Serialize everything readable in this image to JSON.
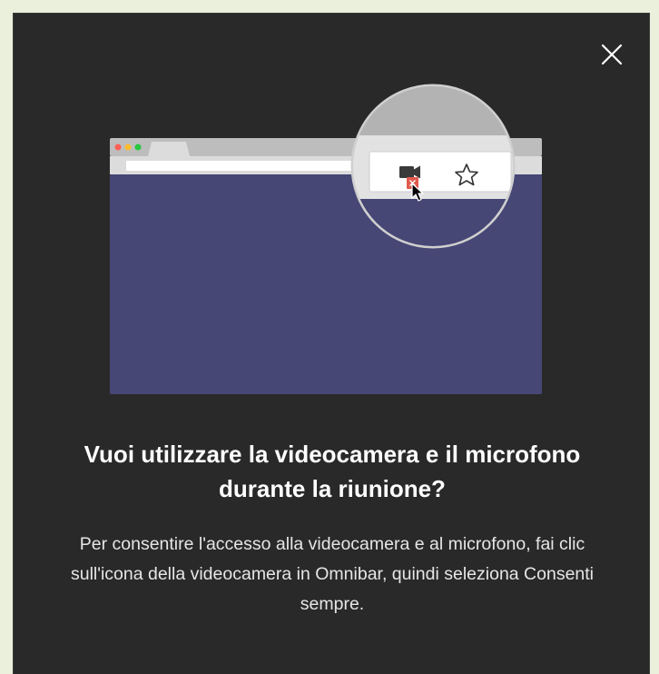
{
  "dialog": {
    "title": "Vuoi utilizzare la videocamera e il microfono durante la riunione?",
    "description": "Per consentire l'accesso alla videocamera e al microfono, fai clic sull'icona della videocamera in Omnibar, quindi seleziona Consenti sempre."
  },
  "icons": {
    "close": "close-icon",
    "camera_blocked": "camera-blocked-icon",
    "star": "star-icon",
    "cursor": "cursor-icon"
  },
  "colors": {
    "dialog_background": "#292929",
    "page_background": "#eaf0dc",
    "browser_content": "#464775",
    "browser_chrome": "#c8c8c8",
    "blocked_badge": "#e05a4e",
    "traffic_red": "#ff5f57",
    "traffic_yellow": "#febc2e",
    "traffic_green": "#28c840"
  }
}
